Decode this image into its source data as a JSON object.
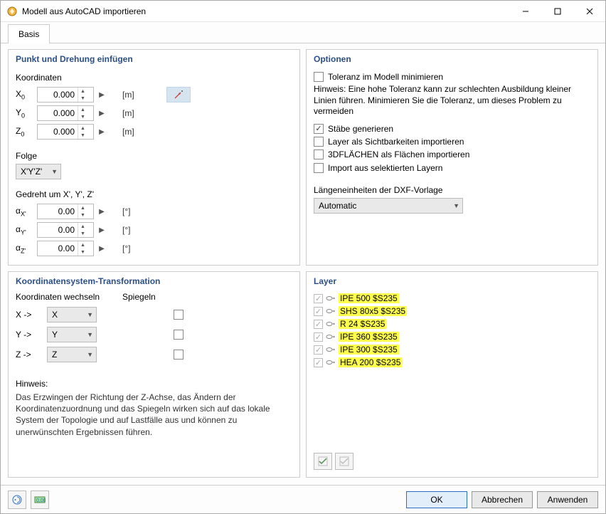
{
  "window": {
    "title": "Modell aus AutoCAD importieren",
    "tab": "Basis"
  },
  "insert": {
    "legend": "Punkt und Drehung einfügen",
    "coord_label": "Koordinaten",
    "rows": {
      "x": {
        "label": "X",
        "sub": "0",
        "value": "0.000",
        "unit": "[m]"
      },
      "y": {
        "label": "Y",
        "sub": "0",
        "value": "0.000",
        "unit": "[m]"
      },
      "z": {
        "label": "Z",
        "sub": "0",
        "value": "0.000",
        "unit": "[m]"
      }
    },
    "folge_label": "Folge",
    "folge_value": "X'Y'Z'",
    "gedreht_label": "Gedreht um X', Y', Z'",
    "rot": {
      "ax": {
        "label": "αX'",
        "value": "0.00",
        "unit": "[°]"
      },
      "ay": {
        "label": "αY'",
        "value": "0.00",
        "unit": "[°]"
      },
      "az": {
        "label": "αZ'",
        "value": "0.00",
        "unit": "[°]"
      }
    }
  },
  "transform": {
    "legend": "Koordinatensystem-Transformation",
    "swap_label": "Koordinaten wechseln",
    "mirror_label": "Spiegeln",
    "rows": {
      "x": {
        "from": "X ->",
        "to": "X"
      },
      "y": {
        "from": "Y ->",
        "to": "Y"
      },
      "z": {
        "from": "Z ->",
        "to": "Z"
      }
    },
    "hinweis_label": "Hinweis:",
    "hinweis_text": "Das Erzwingen der Richtung der Z-Achse, das Ändern der Koordinatenzuordnung und das Spiegeln wirken sich auf das lokale System der Topologie und auf Lastfälle aus und können zu unerwünschten Ergebnissen führen."
  },
  "options": {
    "legend": "Optionen",
    "tol_label": "Toleranz im Modell minimieren",
    "tol_checked": false,
    "tol_note": "Hinweis: Eine hohe Toleranz kann zur schlechten Ausbildung kleiner Linien führen. Minimieren Sie die Toleranz, um dieses Problem zu vermeiden",
    "staebe": {
      "label": "Stäbe generieren",
      "checked": true
    },
    "layer_vis": {
      "label": "Layer als Sichtbarkeiten importieren",
      "checked": false
    },
    "faces3d": {
      "label": "3DFLÄCHEN als Flächen importieren",
      "checked": false
    },
    "sel_layers": {
      "label": "Import aus selektierten Layern",
      "checked": false
    },
    "len_unit_label": "Längeneinheiten der DXF-Vorlage",
    "len_unit_value": "Automatic"
  },
  "layers": {
    "legend": "Layer",
    "items": [
      {
        "name": "IPE 500 $S235",
        "checked": true
      },
      {
        "name": "SHS 80x5 $S235",
        "checked": true
      },
      {
        "name": "R 24 $S235",
        "checked": true
      },
      {
        "name": "IPE 360 $S235",
        "checked": true
      },
      {
        "name": "IPE 300 $S235",
        "checked": true
      },
      {
        "name": "HEA 200 $S235",
        "checked": true
      }
    ]
  },
  "footer": {
    "ok": "OK",
    "cancel": "Abbrechen",
    "apply": "Anwenden"
  }
}
